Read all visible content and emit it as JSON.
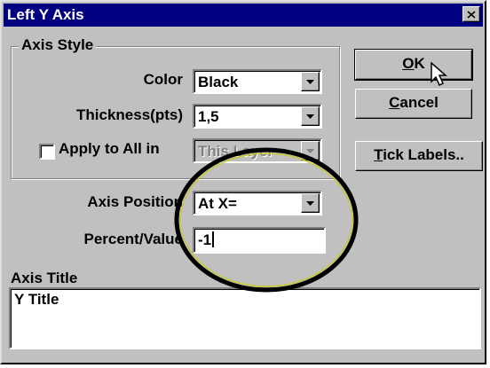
{
  "window": {
    "title": "Left Y Axis",
    "close_symbol": "✕"
  },
  "axis_style": {
    "legend": "Axis Style",
    "color_label": "Color",
    "color_value": "Black",
    "thickness_label": "Thickness(pts)",
    "thickness_value": "1,5",
    "apply_label": "Apply to All in",
    "apply_checked": false,
    "apply_value": "This Layer"
  },
  "position": {
    "axis_position_label": "Axis Position",
    "axis_position_value": "At X=",
    "percent_label": "Percent/Value",
    "percent_value": "-1"
  },
  "axis_title": {
    "label": "Axis Title",
    "value": "Y Title"
  },
  "buttons": {
    "ok_mnemonic": "O",
    "ok_rest": "K",
    "cancel_mnemonic": "C",
    "cancel_rest": "ancel",
    "tick_mnemonic": "T",
    "tick_rest": "ick Labels.."
  },
  "colors": {
    "titlebar": "#000080",
    "face": "#c0c0c0",
    "annotation_circle": "#000000",
    "annotation_inner": "#c8c832"
  },
  "icons": [
    "close-icon",
    "dropdown-arrow-icon",
    "mouse-cursor-icon"
  ]
}
